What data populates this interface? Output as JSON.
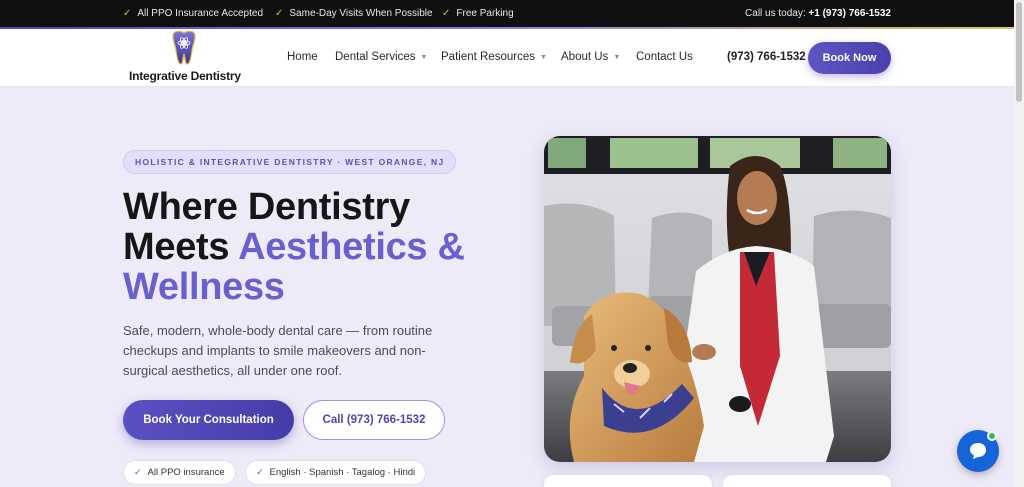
{
  "topbar": {
    "items": [
      "All PPO Insurance Accepted",
      "Same-Day Visits When Possible",
      "Free Parking"
    ],
    "call_label": "Call us today:",
    "call_number": "+1 (973) 766-1532"
  },
  "nav": {
    "brand": "Integrative Dentistry",
    "menu": [
      "Home",
      "Dental Services",
      "Patient Resources",
      "About Us",
      "Contact Us"
    ],
    "phone": "(973) 766-1532",
    "book_label": "Book Now"
  },
  "hero": {
    "eyebrow": "HOLISTIC & INTEGRATIVE DENTISTRY · WEST ORANGE, NJ",
    "headline_line1": "Where Dentistry",
    "headline_line2a": "Meets ",
    "headline_line2b": "Aesthetics &",
    "headline_line3": "Wellness",
    "description": "Safe, modern, whole-body dental care — from routine checkups and implants to smile makeovers and non-surgical aesthetics, all under one roof.",
    "cta_primary": "Book Your Consultation",
    "cta_secondary": "Call (973) 766-1532",
    "chips": [
      "All PPO insurance",
      "English · Spanish · Tagalog · Hindi"
    ]
  },
  "colors": {
    "accent": "#6a5fcf",
    "button": "#4a40ad",
    "check": "#e3b93a",
    "chat": "#1565d8"
  }
}
